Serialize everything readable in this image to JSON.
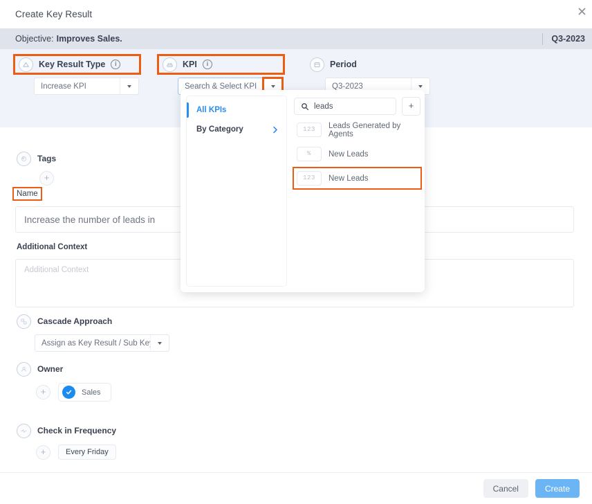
{
  "dialog": {
    "title": "Create Key Result",
    "close_icon": "close-icon"
  },
  "objective": {
    "label": "Objective:",
    "value": "Improves Sales.",
    "period_badge": "Q3-2023"
  },
  "top_fields": {
    "key_result_type": {
      "label": "Key Result Type",
      "icon": "triangle-up-circle-icon",
      "info_icon": "info-icon",
      "value": "Increase KPI",
      "highlighted": true
    },
    "kpi": {
      "label": "KPI",
      "icon": "kpi-stack-icon",
      "info_icon": "info-icon",
      "placeholder": "Search & Select KPI",
      "highlighted": true,
      "caret_highlighted": true
    },
    "period": {
      "label": "Period",
      "icon": "calendar-icon",
      "value": "Q3-2023"
    }
  },
  "kpi_dropdown": {
    "categories": [
      {
        "label": "All KPIs",
        "active": true
      },
      {
        "label": "By Category",
        "active": false,
        "chevron": "chevron-right-icon"
      }
    ],
    "search": {
      "value": "leads",
      "icon": "search-icon"
    },
    "add_button": "+",
    "results": [
      {
        "badge": "123",
        "name": "Leads Generated by Agents",
        "highlighted": false
      },
      {
        "badge": "%",
        "name": "New Leads",
        "highlighted": false
      },
      {
        "badge": "123",
        "name": "New Leads",
        "highlighted": true
      }
    ]
  },
  "form": {
    "tags": {
      "label": "Tags",
      "icon": "tag-icon",
      "add_button": "+"
    },
    "name": {
      "label": "Name",
      "value": "Increase the number of leads in",
      "highlighted": true
    },
    "additional_context": {
      "label": "Additional Context",
      "placeholder": "Additional Context"
    },
    "cascade_approach": {
      "label": "Cascade Approach",
      "icon": "cascade-icon",
      "value": "Assign as Key Result / Sub Key …"
    },
    "owner": {
      "label": "Owner",
      "icon": "user-icon",
      "add_button": "+",
      "chip": {
        "name": "Sales",
        "avatar_icon": "check-badge-icon"
      }
    },
    "check_in_frequency": {
      "label": "Check in Frequency",
      "icon": "pulse-icon",
      "add_button": "+",
      "chip": "Every Friday"
    }
  },
  "footer": {
    "cancel_label": "Cancel",
    "create_label": "Create"
  },
  "colors": {
    "highlight": "#ec5d11",
    "accent_blue": "#2a8ef0",
    "create_button": "#6cb5f5",
    "objective_bar": "#dfe3ec",
    "form_band": "#f0f4fa"
  }
}
